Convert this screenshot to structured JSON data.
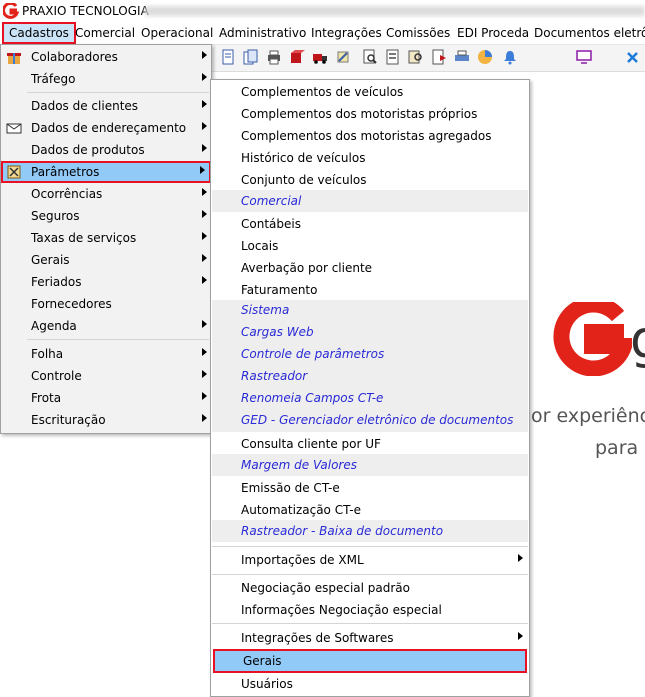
{
  "window": {
    "title": "PRAXIO TECNOLOGIA"
  },
  "menubar": {
    "items": [
      "Cadastros",
      "Comercial",
      "Operacional",
      "Administrativo",
      "Integrações",
      "Comissões",
      "EDI Proceda",
      "Documentos eletrônic"
    ]
  },
  "cadastros_menu": {
    "items": [
      {
        "label": "Colaboradores"
      },
      {
        "label": "Tráfego"
      },
      {
        "label": "Dados de clientes"
      },
      {
        "label": "Dados de endereçamento"
      },
      {
        "label": "Dados de produtos"
      },
      {
        "label": "Parâmetros"
      },
      {
        "label": "Ocorrências"
      },
      {
        "label": "Seguros"
      },
      {
        "label": "Taxas de serviços"
      },
      {
        "label": "Gerais"
      },
      {
        "label": "Feriados"
      },
      {
        "label": "Fornecedores"
      },
      {
        "label": "Agenda"
      },
      {
        "label": "Folha"
      },
      {
        "label": "Controle"
      },
      {
        "label": "Frota"
      },
      {
        "label": "Escrituração"
      }
    ]
  },
  "parametros_menu": {
    "items": [
      {
        "label": "Complementos de veículos"
      },
      {
        "label": "Complementos dos motoristas próprios"
      },
      {
        "label": "Complementos dos motoristas agregados"
      },
      {
        "label": "Histórico de veículos"
      },
      {
        "label": "Conjunto de veículos"
      },
      {
        "label": "Comercial"
      },
      {
        "label": "Contábeis"
      },
      {
        "label": "Locais"
      },
      {
        "label": "Averbação por cliente"
      },
      {
        "label": "Faturamento"
      },
      {
        "label": "Sistema"
      },
      {
        "label": "Cargas Web"
      },
      {
        "label": "Controle de parâmetros"
      },
      {
        "label": "Rastreador"
      },
      {
        "label": "Renomeia Campos CT-e"
      },
      {
        "label": "GED - Gerenciador eletrônico de documentos"
      },
      {
        "label": "Consulta cliente por UF"
      },
      {
        "label": "Margem de Valores"
      },
      {
        "label": "Emissão de CT-e"
      },
      {
        "label": "Automatização CT-e"
      },
      {
        "label": "Rastreador - Baixa de documento"
      },
      {
        "label": "Importações de XML"
      },
      {
        "label": "Negociação especial padrão"
      },
      {
        "label": "Informações Negociação especial"
      },
      {
        "label": "Integrações de Softwares"
      },
      {
        "label": "Gerais"
      },
      {
        "label": "Usuários"
      }
    ]
  },
  "background": {
    "line1": "or experiênc",
    "line2": "para"
  },
  "colors": {
    "highlight_border": "#e81123",
    "highlight_fill": "#91c9f7",
    "section_text": "#2a2ad6",
    "brand_red": "#e2231a"
  }
}
